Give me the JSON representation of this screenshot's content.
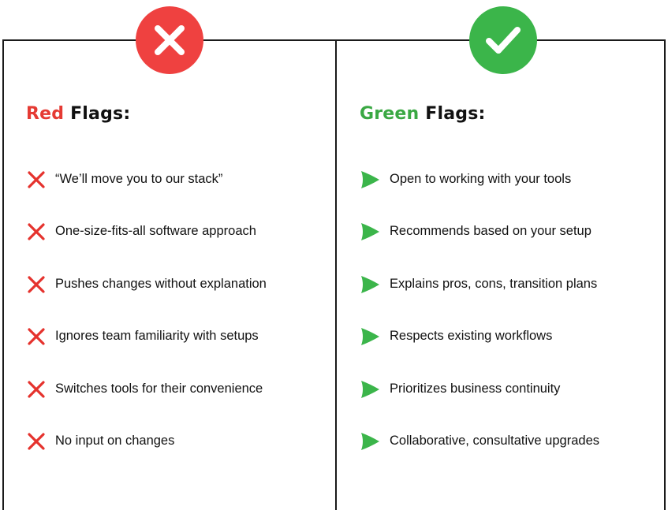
{
  "colors": {
    "red": "#ef4140",
    "green": "#3bb54a"
  },
  "icons": {
    "left_badge": "x-mark-icon",
    "right_badge": "checkmark-icon",
    "red_item": "red-x-icon",
    "green_item": "green-triangle-arrow-icon"
  },
  "left": {
    "heading_accent": "Red",
    "heading_rest": "Flags:",
    "items": [
      "“We’ll move you to our stack”",
      "One-size-fits-all software approach",
      "Pushes changes without explanation",
      "Ignores team familiarity with setups",
      "Switches tools for their convenience",
      "No input on changes"
    ]
  },
  "right": {
    "heading_accent": "Green",
    "heading_rest": "Flags:",
    "items": [
      "Open to working with your tools",
      "Recommends based on your setup",
      "Explains pros, cons, transition plans",
      "Respects existing workflows",
      "Prioritizes business continuity",
      "Collaborative, consultative upgrades"
    ]
  }
}
